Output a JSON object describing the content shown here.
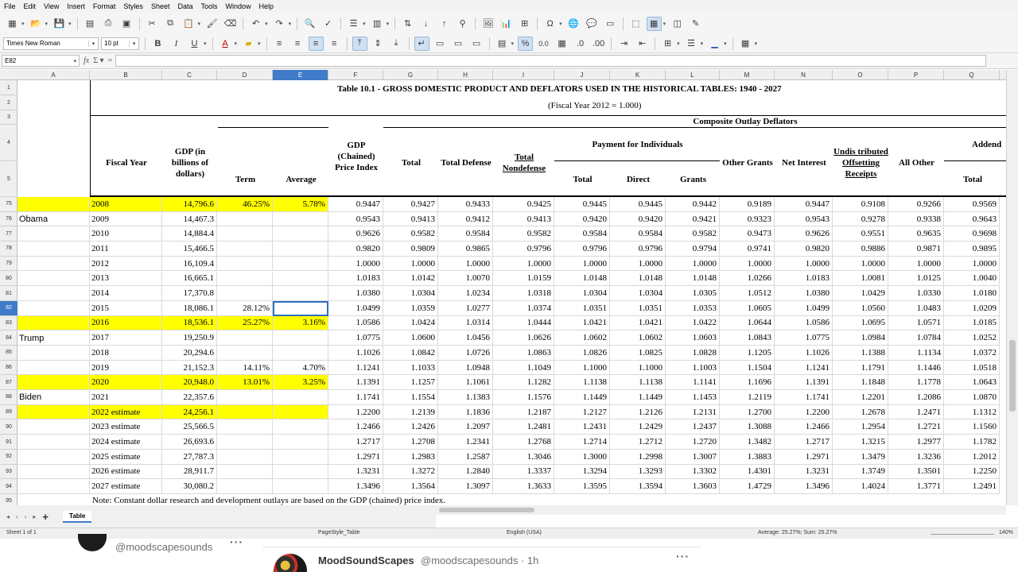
{
  "menubar": [
    "File",
    "Edit",
    "View",
    "Insert",
    "Format",
    "Styles",
    "Sheet",
    "Data",
    "Tools",
    "Window",
    "Help"
  ],
  "toolbar": {
    "font_name": "Times New Roman",
    "font_size": "10 pt",
    "bold": "B",
    "italic": "I",
    "underline": "U",
    "percent": "%",
    "decimal": "0.0"
  },
  "formula_bar": {
    "cell_ref": "E82",
    "value": ""
  },
  "columns": [
    "A",
    "B",
    "C",
    "D",
    "E",
    "F",
    "G",
    "H",
    "I",
    "J",
    "K",
    "L",
    "M",
    "N",
    "O",
    "P",
    "Q"
  ],
  "selected_column": "E",
  "selected_row": "82",
  "header_rows": [
    "1",
    "2",
    "3",
    "4",
    "5"
  ],
  "table": {
    "title": "Table 10.1 - GROSS DOMESTIC PRODUCT AND DEFLATORS USED IN THE HISTORICAL TABLES:  1940 - 2027",
    "subtitle": "(Fiscal Year 2012 = 1.000)",
    "composite": "Composite Outlay Deflators",
    "fiscal_year": "Fiscal Year",
    "gdp": "GDP (in billions of dollars)",
    "term": "Term",
    "average": "Average",
    "price_index": "GDP (Chained) Price Index",
    "total": "Total",
    "total_defense": "Total Defense",
    "total_nondefense": "Total Nondefense",
    "payment": "Payment for Individuals",
    "pay_total": "Total",
    "direct": "Direct",
    "grants": "Grants",
    "other_grants": "Other Grants",
    "net_interest": "Net Interest",
    "undistributed": "Undis tributed Offsetting Receipts",
    "all_other": "All Other",
    "addenda": "Addend",
    "addenda_total": "Total",
    "note": "Note: Constant dollar research and development outlays are based on the GDP (chained) price index."
  },
  "presidents": [
    "Obama",
    "Trump",
    "Biden"
  ],
  "rows": [
    {
      "row": "75",
      "year": "2008",
      "gdp": "14,796.6",
      "term": "46.25%",
      "avg": "5.78%",
      "vals": [
        "0.9447",
        "0.9427",
        "0.9433",
        "0.9425",
        "0.9445",
        "0.9445",
        "0.9442",
        "0.9189",
        "0.9447",
        "0.9108",
        "0.9266",
        "0.9569"
      ],
      "hl": true
    },
    {
      "row": "76",
      "year": "2009",
      "gdp": "14,467.3",
      "term": "",
      "avg": "",
      "vals": [
        "0.9543",
        "0.9413",
        "0.9412",
        "0.9413",
        "0.9420",
        "0.9420",
        "0.9421",
        "0.9323",
        "0.9543",
        "0.9278",
        "0.9338",
        "0.9643"
      ],
      "hl": false
    },
    {
      "row": "77",
      "year": "2010",
      "gdp": "14,884.4",
      "term": "",
      "avg": "",
      "vals": [
        "0.9626",
        "0.9582",
        "0.9584",
        "0.9582",
        "0.9584",
        "0.9584",
        "0.9582",
        "0.9473",
        "0.9626",
        "0.9551",
        "0.9635",
        "0.9698"
      ],
      "hl": false
    },
    {
      "row": "78",
      "year": "2011",
      "gdp": "15,466.5",
      "term": "",
      "avg": "",
      "vals": [
        "0.9820",
        "0.9809",
        "0.9865",
        "0.9796",
        "0.9796",
        "0.9796",
        "0.9794",
        "0.9741",
        "0.9820",
        "0.9886",
        "0.9871",
        "0.9895"
      ],
      "hl": false
    },
    {
      "row": "79",
      "year": "2012",
      "gdp": "16,109.4",
      "term": "",
      "avg": "",
      "vals": [
        "1.0000",
        "1.0000",
        "1.0000",
        "1.0000",
        "1.0000",
        "1.0000",
        "1.0000",
        "1.0000",
        "1.0000",
        "1.0000",
        "1.0000",
        "1.0000"
      ],
      "hl": false
    },
    {
      "row": "80",
      "year": "2013",
      "gdp": "16,665.1",
      "term": "",
      "avg": "",
      "vals": [
        "1.0183",
        "1.0142",
        "1.0070",
        "1.0159",
        "1.0148",
        "1.0148",
        "1.0148",
        "1.0266",
        "1.0183",
        "1.0081",
        "1.0125",
        "1.0040"
      ],
      "hl": false
    },
    {
      "row": "81",
      "year": "2014",
      "gdp": "17,370.8",
      "term": "",
      "avg": "",
      "vals": [
        "1.0380",
        "1.0304",
        "1.0234",
        "1.0318",
        "1.0304",
        "1.0304",
        "1.0305",
        "1.0512",
        "1.0380",
        "1.0429",
        "1.0330",
        "1.0180"
      ],
      "hl": false
    },
    {
      "row": "82",
      "year": "2015",
      "gdp": "18,086.1",
      "term": "28.12%",
      "avg": "",
      "vals": [
        "1.0499",
        "1.0359",
        "1.0277",
        "1.0374",
        "1.0351",
        "1.0351",
        "1.0353",
        "1.0605",
        "1.0499",
        "1.0560",
        "1.0483",
        "1.0209"
      ],
      "hl": false
    },
    {
      "row": "83",
      "year": "2016",
      "gdp": "18,536.1",
      "term": "25.27%",
      "avg": "3.16%",
      "vals": [
        "1.0586",
        "1.0424",
        "1.0314",
        "1.0444",
        "1.0421",
        "1.0421",
        "1.0422",
        "1.0644",
        "1.0586",
        "1.0695",
        "1.0571",
        "1.0185"
      ],
      "hl": true
    },
    {
      "row": "84",
      "year": "2017",
      "gdp": "19,250.9",
      "term": "",
      "avg": "",
      "vals": [
        "1.0775",
        "1.0600",
        "1.0456",
        "1.0626",
        "1.0602",
        "1.0602",
        "1.0603",
        "1.0843",
        "1.0775",
        "1.0984",
        "1.0784",
        "1.0252"
      ],
      "hl": false
    },
    {
      "row": "85",
      "year": "2018",
      "gdp": "20,294.6",
      "term": "",
      "avg": "",
      "vals": [
        "1.1026",
        "1.0842",
        "1.0726",
        "1.0863",
        "1.0826",
        "1.0825",
        "1.0828",
        "1.1205",
        "1.1026",
        "1.1388",
        "1.1134",
        "1.0372"
      ],
      "hl": false
    },
    {
      "row": "86",
      "year": "2019",
      "gdp": "21,152.3",
      "term": "14.11%",
      "avg": "4.70%",
      "vals": [
        "1.1241",
        "1.1033",
        "1.0948",
        "1.1049",
        "1.1000",
        "1.1000",
        "1.1003",
        "1.1504",
        "1.1241",
        "1.1791",
        "1.1446",
        "1.0518"
      ],
      "hl": false
    },
    {
      "row": "87",
      "year": "2020",
      "gdp": "20,948.0",
      "term": "13.01%",
      "avg": "3.25%",
      "vals": [
        "1.1391",
        "1.1257",
        "1.1061",
        "1.1282",
        "1.1138",
        "1.1138",
        "1.1141",
        "1.1696",
        "1.1391",
        "1.1848",
        "1.1778",
        "1.0643"
      ],
      "hl": true
    },
    {
      "row": "88",
      "year": "2021",
      "gdp": "22,357.6",
      "term": "",
      "avg": "",
      "vals": [
        "1.1741",
        "1.1554",
        "1.1383",
        "1.1576",
        "1.1449",
        "1.1449",
        "1.1453",
        "1.2119",
        "1.1741",
        "1.2201",
        "1.2086",
        "1.0870"
      ],
      "hl": false
    },
    {
      "row": "89",
      "year": "2022 estimate",
      "gdp": "24,256.1",
      "term": "",
      "avg": "",
      "vals": [
        "1.2200",
        "1.2139",
        "1.1836",
        "1.2187",
        "1.2127",
        "1.2126",
        "1.2131",
        "1.2700",
        "1.2200",
        "1.2678",
        "1.2471",
        "1.1312"
      ],
      "hl": true
    },
    {
      "row": "90",
      "year": "2023 estimate",
      "gdp": "25,566.5",
      "term": "",
      "avg": "",
      "vals": [
        "1.2466",
        "1.2426",
        "1.2097",
        "1.2481",
        "1.2431",
        "1.2429",
        "1.2437",
        "1.3088",
        "1.2466",
        "1.2954",
        "1.2721",
        "1.1560"
      ],
      "hl": false
    },
    {
      "row": "91",
      "year": "2024 estimate",
      "gdp": "26,693.6",
      "term": "",
      "avg": "",
      "vals": [
        "1.2717",
        "1.2708",
        "1.2341",
        "1.2768",
        "1.2714",
        "1.2712",
        "1.2720",
        "1.3482",
        "1.2717",
        "1.3215",
        "1.2977",
        "1.1782"
      ],
      "hl": false
    },
    {
      "row": "92",
      "year": "2025 estimate",
      "gdp": "27,787.3",
      "term": "",
      "avg": "",
      "vals": [
        "1.2971",
        "1.2983",
        "1.2587",
        "1.3046",
        "1.3000",
        "1.2998",
        "1.3007",
        "1.3883",
        "1.2971",
        "1.3479",
        "1.3236",
        "1.2012"
      ],
      "hl": false
    },
    {
      "row": "93",
      "year": "2026 estimate",
      "gdp": "28,911.7",
      "term": "",
      "avg": "",
      "vals": [
        "1.3231",
        "1.3272",
        "1.2840",
        "1.3337",
        "1.3294",
        "1.3293",
        "1.3302",
        "1.4301",
        "1.3231",
        "1.3749",
        "1.3501",
        "1.2250"
      ],
      "hl": false
    },
    {
      "row": "94",
      "year": "2027 estimate",
      "gdp": "30,080.2",
      "term": "",
      "avg": "",
      "vals": [
        "1.3496",
        "1.3564",
        "1.3097",
        "1.3633",
        "1.3595",
        "1.3594",
        "1.3603",
        "1.4729",
        "1.3496",
        "1.4024",
        "1.3771",
        "1.2491"
      ],
      "hl": false
    }
  ],
  "note_row": "95",
  "sheet_tab": "Table",
  "status": {
    "sheet": "Sheet 1 of 1",
    "page_style": "PageStyle_Table",
    "language": "English (USA)",
    "summary": "Average: 25.27%; Sum: 25.27%",
    "zoom": "140%"
  },
  "social": {
    "handle_top": "@moodscapesounds",
    "author": "MoodSoundScapes",
    "author_handle": "@moodscapesounds · 1h"
  },
  "colors": {
    "highlight": "#ffff00",
    "selection": "#3f7bc8"
  }
}
